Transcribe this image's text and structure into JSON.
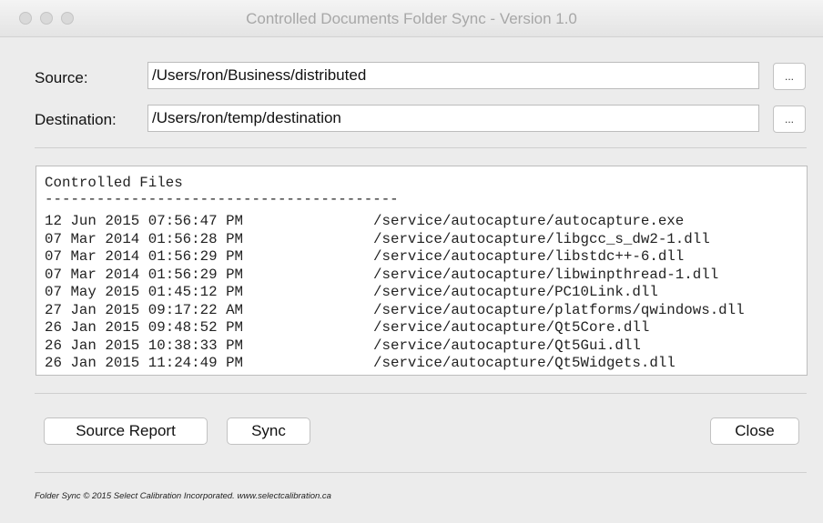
{
  "window": {
    "title": "Controlled Documents Folder Sync - Version 1.0"
  },
  "source": {
    "label": "Source:",
    "value": "/Users/ron/Business/distributed",
    "browse_label": "..."
  },
  "destination": {
    "label": "Destination:",
    "value": "/Users/ron/temp/destination",
    "browse_label": "..."
  },
  "listing": {
    "header": "Controlled Files",
    "rule": "-----------------------------------------",
    "rows": [
      {
        "date": "12 Jun 2015 07:56:47 PM",
        "path": "/service/autocapture/autocapture.exe"
      },
      {
        "date": "07 Mar 2014 01:56:28 PM",
        "path": "/service/autocapture/libgcc_s_dw2-1.dll"
      },
      {
        "date": "07 Mar 2014 01:56:29 PM",
        "path": "/service/autocapture/libstdc++-6.dll"
      },
      {
        "date": "07 Mar 2014 01:56:29 PM",
        "path": "/service/autocapture/libwinpthread-1.dll"
      },
      {
        "date": "07 May 2015 01:45:12 PM",
        "path": "/service/autocapture/PC10Link.dll"
      },
      {
        "date": "27 Jan 2015 09:17:22 AM",
        "path": "/service/autocapture/platforms/qwindows.dll"
      },
      {
        "date": "26 Jan 2015 09:48:52 PM",
        "path": "/service/autocapture/Qt5Core.dll"
      },
      {
        "date": "26 Jan 2015 10:38:33 PM",
        "path": "/service/autocapture/Qt5Gui.dll"
      },
      {
        "date": "26 Jan 2015 11:24:49 PM",
        "path": "/service/autocapture/Qt5Widgets.dll"
      }
    ]
  },
  "buttons": {
    "source_report": "Source Report",
    "sync": "Sync",
    "close": "Close"
  },
  "footer": {
    "text": "Folder Sync © 2015 Select Calibration Incorporated.  www.selectcalibration.ca"
  }
}
